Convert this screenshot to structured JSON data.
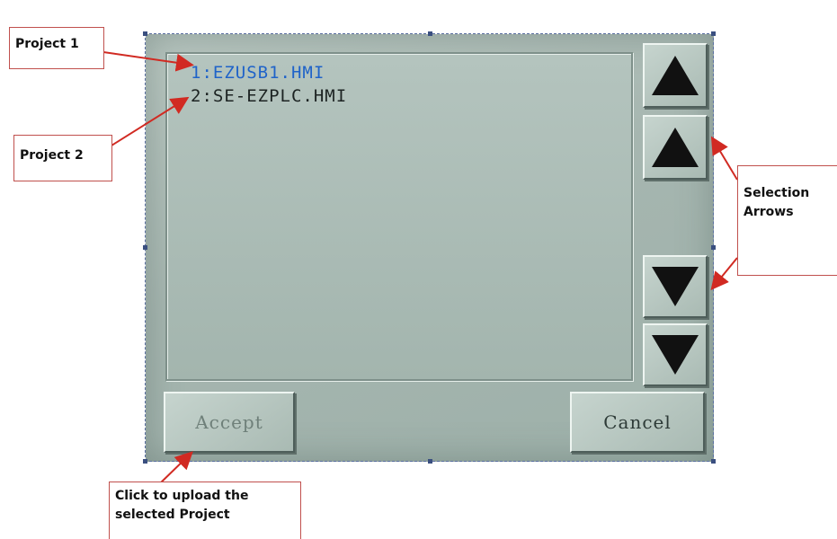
{
  "list": {
    "items": [
      {
        "label": "1:EZUSB1.HMI",
        "selected": true
      },
      {
        "label": "2:SE-EZPLC.HMI",
        "selected": false
      }
    ]
  },
  "buttons": {
    "accept_label": "Accept",
    "cancel_label": "Cancel",
    "arrow_icons": [
      "page-up-icon",
      "line-up-icon",
      "line-down-icon",
      "page-down-icon"
    ]
  },
  "annotations": {
    "project1": "Project 1",
    "project2": "Project 2",
    "selection_arrows": "Selection Arrows",
    "accept_note": "Click to upload the selected Project"
  },
  "colors": {
    "selected_text": "#1f63c9",
    "callout_border": "#c0504d",
    "annotation_arrow": "#d12a22"
  }
}
